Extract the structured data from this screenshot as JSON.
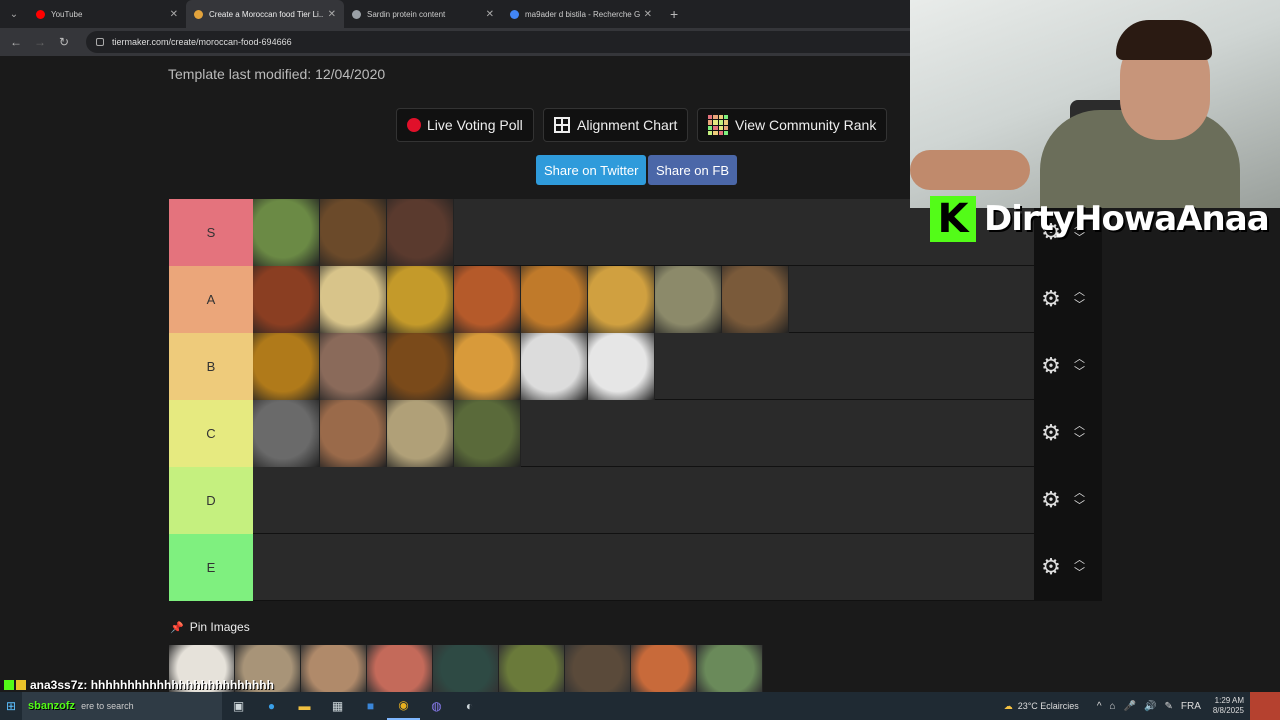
{
  "browser": {
    "tabs": [
      {
        "title": "YouTube",
        "favicon_color": "#ff0000",
        "active": false
      },
      {
        "title": "Create a Moroccan food Tier Li...",
        "favicon_color": "#e2a33c",
        "active": true
      },
      {
        "title": "Sardin protein content",
        "favicon_color": "#9aa0a6",
        "active": false
      },
      {
        "title": "ma9ader d bistila - Recherche G...",
        "favicon_color": "#4285f4",
        "active": false
      }
    ],
    "new_tab_label": "+",
    "url": "tiermaker.com/create/moroccan-food-694666"
  },
  "page": {
    "modified_text": "Template last modified: 12/04/2020",
    "buttons": {
      "live_voting": "Live Voting Poll",
      "alignment": "Alignment Chart",
      "community_rank": "View Community Rank"
    },
    "share": {
      "twitter": "Share on Twitter",
      "fb": "Share on FB",
      "twitter_color": "#2f9bdb",
      "fb_color": "#4b67a8"
    },
    "tiers": [
      {
        "label": "S",
        "color": "#e4737d",
        "items": [
          "#6b8a45",
          "#6b4a2a",
          "#5a3a2e"
        ]
      },
      {
        "label": "A",
        "color": "#eba67a",
        "items": [
          "#8a3e22",
          "#d8c48a",
          "#c49a2a",
          "#b55a2a",
          "#c07a2a",
          "#d0a040",
          "#8c8a6a",
          "#7a5a3a"
        ]
      },
      {
        "label": "B",
        "color": "#eecb7b",
        "items": [
          "#b07a1a",
          "#8a6a5a",
          "#7a4a1a",
          "#d89a3a",
          "#dcdcdc",
          "#e6e6e6"
        ]
      },
      {
        "label": "C",
        "color": "#e6ea80",
        "items": [
          "#6a6a6a",
          "#9a6a4a",
          "#b0a078",
          "#5a6a3a"
        ]
      },
      {
        "label": "D",
        "color": "#c5f07f",
        "items": []
      },
      {
        "label": "E",
        "color": "#7ff07f",
        "items": []
      }
    ],
    "pin_label": "Pin Images",
    "pool_items": [
      "#e6e2da",
      "#a89478",
      "#b08a6a",
      "#c46a5a",
      "#2e4a44",
      "#6a7a3a",
      "#5a4a3a",
      "#c86a3a",
      "#6a8a5a"
    ]
  },
  "overlay": {
    "channel_name": "DirtyHowaAnaa",
    "chat_user": "ana3ss7z",
    "chat_message": ": hhhhhhhhhhhhhhhhhhhhhhhhh",
    "kick_green": "#53fc18"
  },
  "taskbar": {
    "search_user": "sbanzofz",
    "search_placeholder": "ere to search",
    "weather": "23°C  Eclaircies",
    "lang": "FRA",
    "time": "1:29 AM",
    "date": "8/8/2025"
  }
}
